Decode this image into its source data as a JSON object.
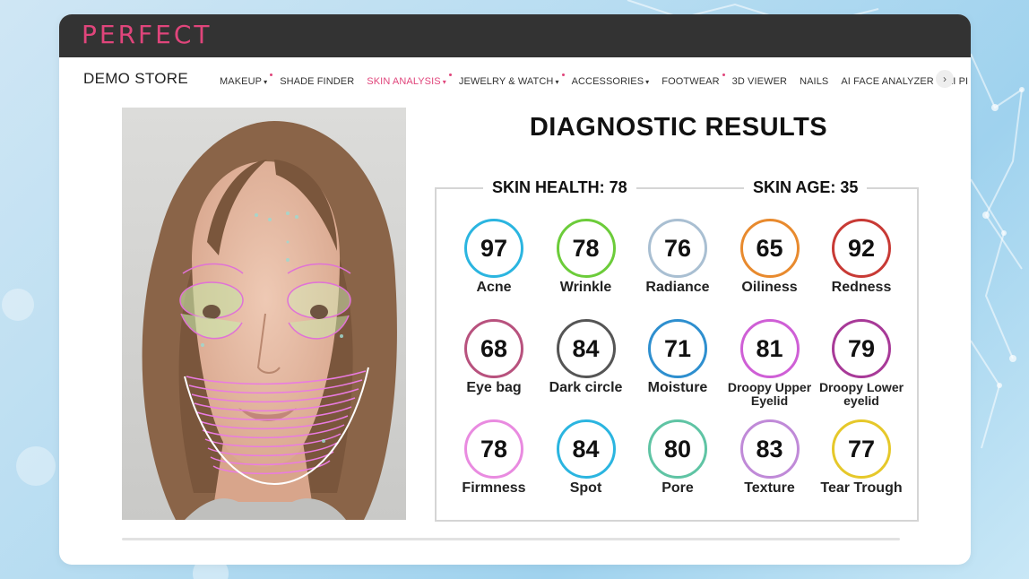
{
  "brand": {
    "logo_text": "PERFECT",
    "accent_color": "#e0457b"
  },
  "nav": {
    "store_name": "DEMO STORE",
    "items": [
      {
        "label": "MAKEUP",
        "has_caret": true,
        "has_dot": true,
        "active": false
      },
      {
        "label": "SHADE FINDER",
        "has_caret": false,
        "has_dot": false,
        "active": false
      },
      {
        "label": "SKIN ANALYSIS",
        "has_caret": true,
        "has_dot": true,
        "active": true
      },
      {
        "label": "JEWELRY & WATCH",
        "has_caret": true,
        "has_dot": true,
        "active": false
      },
      {
        "label": "ACCESSORIES",
        "has_caret": true,
        "has_dot": false,
        "active": false
      },
      {
        "label": "FOOTWEAR",
        "has_caret": false,
        "has_dot": true,
        "active": false
      },
      {
        "label": "3D VIEWER",
        "has_caret": false,
        "has_dot": false,
        "active": false
      },
      {
        "label": "NAILS",
        "has_caret": false,
        "has_dot": false,
        "active": false
      },
      {
        "label": "AI FACE ANALYZER",
        "has_caret": false,
        "has_dot": false,
        "active": false
      },
      {
        "label": "AI PI",
        "has_caret": false,
        "has_dot": false,
        "active": false
      }
    ],
    "next_icon": "chevron-right-icon"
  },
  "results": {
    "title": "DIAGNOSTIC RESULTS",
    "skin_health_label": "SKIN HEALTH: 78",
    "skin_age_label": "SKIN AGE: 35",
    "metrics": [
      {
        "name": "Acne",
        "value": "97",
        "color": "#2bb5e0"
      },
      {
        "name": "Wrinkle",
        "value": "78",
        "color": "#6ccc3a"
      },
      {
        "name": "Radiance",
        "value": "76",
        "color": "#a9bfd2"
      },
      {
        "name": "Oiliness",
        "value": "65",
        "color": "#e88a2e"
      },
      {
        "name": "Redness",
        "value": "92",
        "color": "#c83a35"
      },
      {
        "name": "Eye bag",
        "value": "68",
        "color": "#b8527e"
      },
      {
        "name": "Dark circle",
        "value": "84",
        "color": "#555555"
      },
      {
        "name": "Moisture",
        "value": "71",
        "color": "#2e8fcf"
      },
      {
        "name": "Droopy Upper Eyelid",
        "value": "81",
        "color": "#cf5fd6"
      },
      {
        "name": "Droopy Lower eyelid",
        "value": "79",
        "color": "#a83a98"
      },
      {
        "name": "Firmness",
        "value": "78",
        "color": "#e98be0"
      },
      {
        "name": "Spot",
        "value": "84",
        "color": "#2bb5e0"
      },
      {
        "name": "Pore",
        "value": "80",
        "color": "#5fc4a4"
      },
      {
        "name": "Texture",
        "value": "83",
        "color": "#c08ad8"
      },
      {
        "name": "Tear Trough",
        "value": "77",
        "color": "#e6c82a"
      }
    ]
  }
}
